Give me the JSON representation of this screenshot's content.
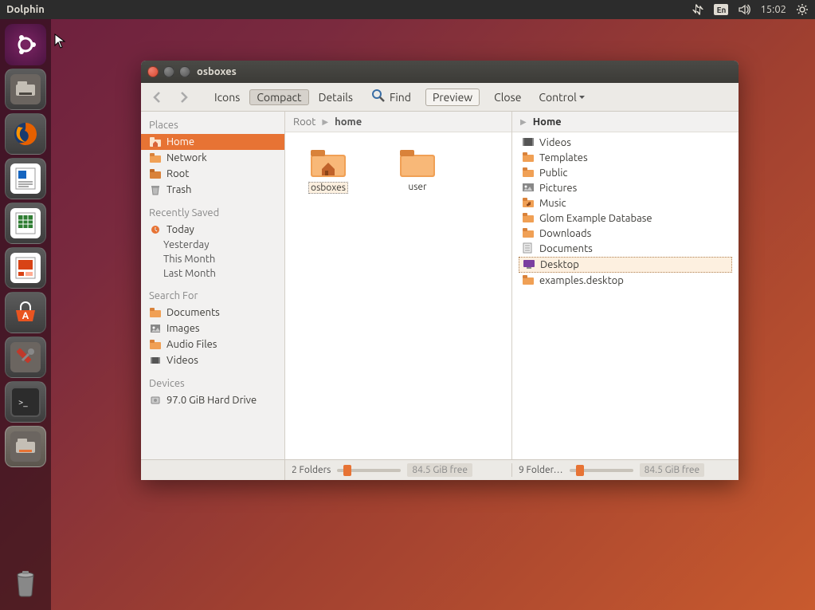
{
  "top_bar": {
    "app_name": "Dolphin",
    "lang": "En",
    "time": "15:02"
  },
  "window": {
    "title": "osboxes",
    "toolbar": {
      "views": {
        "icons": "Icons",
        "compact": "Compact",
        "details": "Details"
      },
      "find": "Find",
      "preview": "Preview",
      "close": "Close",
      "control": "Control"
    },
    "places": {
      "header": "Places",
      "items": [
        "Home",
        "Network",
        "Root",
        "Trash"
      ],
      "recent_header": "Recently Saved",
      "recent": [
        "Today",
        "Yesterday",
        "This Month",
        "Last Month"
      ],
      "search_header": "Search For",
      "search": [
        "Documents",
        "Images",
        "Audio Files",
        "Videos"
      ],
      "devices_header": "Devices",
      "devices": [
        "97.0 GiB Hard Drive"
      ]
    },
    "pane1": {
      "crumbs": [
        "Root",
        "home"
      ],
      "files": [
        "osboxes",
        "user"
      ],
      "status_count": "2 Folders",
      "free": "84.5 GiB free"
    },
    "pane2": {
      "crumbs": [
        "Home"
      ],
      "files": [
        "Videos",
        "Templates",
        "Public",
        "Pictures",
        "Music",
        "Glom Example Database",
        "Downloads",
        "Documents",
        "Desktop",
        "examples.desktop"
      ],
      "status_count": "9 Folder…",
      "free": "84.5 GiB free"
    }
  }
}
